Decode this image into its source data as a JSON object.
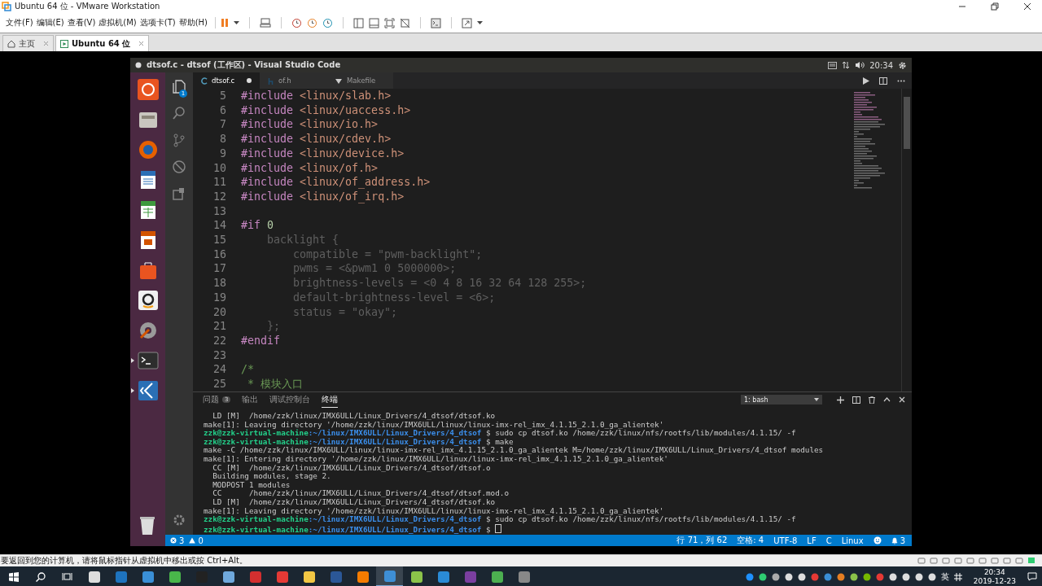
{
  "window": {
    "title": "Ubuntu 64 位 - VMware Workstation"
  },
  "menu": [
    "文件(F)",
    "编辑(E)",
    "查看(V)",
    "虚拟机(M)",
    "选项卡(T)",
    "帮助(H)"
  ],
  "tabs": [
    {
      "label": "主页",
      "kind": "home",
      "selected": false
    },
    {
      "label": "Ubuntu 64 位",
      "kind": "vm",
      "selected": true
    }
  ],
  "ubuntu": {
    "window_title": "dtsof.c - dtsof (工作区) - Visual Studio Code",
    "clock": "20:34",
    "launcher": [
      {
        "running": false
      },
      {
        "running": false
      },
      {
        "running": false
      },
      {
        "running": false
      },
      {
        "running": false
      },
      {
        "running": false
      },
      {
        "running": false
      },
      {
        "running": false
      },
      {
        "running": false
      },
      {
        "running": true
      },
      {
        "running": true
      }
    ]
  },
  "activity_bar": {
    "explorer_badge": "1"
  },
  "editor": {
    "tabs": [
      {
        "label": "dtsof.c",
        "kind": "c",
        "selected": true,
        "modified": true
      },
      {
        "label": "of.h",
        "kind": "h",
        "selected": false,
        "modified": false
      },
      {
        "label": "Makefile",
        "kind": "make",
        "selected": false,
        "modified": false
      }
    ],
    "lines": [
      {
        "number": "5",
        "kind": "directive",
        "directive": "#include",
        "argument": "<linux/slab.h>"
      },
      {
        "number": "6",
        "kind": "directive",
        "directive": "#include",
        "argument": "<linux/uaccess.h>"
      },
      {
        "number": "7",
        "kind": "directive",
        "directive": "#include",
        "argument": "<linux/io.h>"
      },
      {
        "number": "8",
        "kind": "directive",
        "directive": "#include",
        "argument": "<linux/cdev.h>"
      },
      {
        "number": "9",
        "kind": "directive",
        "directive": "#include",
        "argument": "<linux/device.h>"
      },
      {
        "number": "10",
        "kind": "directive",
        "directive": "#include",
        "argument": "<linux/of.h>"
      },
      {
        "number": "11",
        "kind": "directive",
        "directive": "#include",
        "argument": "<linux/of_address.h>"
      },
      {
        "number": "12",
        "kind": "directive",
        "directive": "#include",
        "argument": "<linux/of_irq.h>"
      },
      {
        "number": "13",
        "kind": "blank"
      },
      {
        "number": "14",
        "kind": "directive",
        "directive": "#if",
        "argument": "0"
      },
      {
        "number": "15",
        "kind": "inactive",
        "text": "    backlight {"
      },
      {
        "number": "16",
        "kind": "inactive",
        "text": "        compatible = \"pwm-backlight\";"
      },
      {
        "number": "17",
        "kind": "inactive",
        "text": "        pwms = <&pwm1 0 5000000>;"
      },
      {
        "number": "18",
        "kind": "inactive",
        "text": "        brightness-levels = <0 4 8 16 32 64 128 255>;"
      },
      {
        "number": "19",
        "kind": "inactive",
        "text": "        default-brightness-level = <6>;"
      },
      {
        "number": "20",
        "kind": "inactive",
        "text": "        status = \"okay\";"
      },
      {
        "number": "21",
        "kind": "inactive",
        "text": "    };"
      },
      {
        "number": "22",
        "kind": "directive",
        "directive": "#endif"
      },
      {
        "number": "23",
        "kind": "blank"
      },
      {
        "number": "24",
        "kind": "comment",
        "text": "/*"
      },
      {
        "number": "25",
        "kind": "comment",
        "text": " * 模块入口"
      }
    ]
  },
  "panel": {
    "tabs": [
      {
        "label": "问题",
        "badge": "3",
        "selected": false
      },
      {
        "label": "输出",
        "selected": false
      },
      {
        "label": "调试控制台",
        "selected": false
      },
      {
        "label": "终端",
        "selected": true
      }
    ],
    "terminal_select": "1: bash",
    "lines": [
      {
        "kind": "output",
        "text": "  LD [M]  /home/zzk/linux/IMX6ULL/Linux_Drivers/4_dtsof/dtsof.ko"
      },
      {
        "kind": "output",
        "text": "make[1]: Leaving directory '/home/zzk/linux/IMX6ULL/linux/linux-imx-rel_imx_4.1.15_2.1.0_ga_alientek'"
      },
      {
        "kind": "prompt",
        "user": "zzk@zzk-virtual-machine",
        "path": ":~/linux/IMX6ULL/Linux_Drivers/4_dtsof",
        "command": "$ sudo cp dtsof.ko /home/zzk/linux/nfs/rootfs/lib/modules/4.1.15/ -f",
        "cursor": false
      },
      {
        "kind": "prompt",
        "user": "zzk@zzk-virtual-machine",
        "path": ":~/linux/IMX6ULL/Linux_Drivers/4_dtsof",
        "command": "$ make",
        "cursor": false
      },
      {
        "kind": "output",
        "text": "make -C /home/zzk/linux/IMX6ULL/linux/linux-imx-rel_imx_4.1.15_2.1.0_ga_alientek M=/home/zzk/linux/IMX6ULL/Linux_Drivers/4_dtsof modules"
      },
      {
        "kind": "output",
        "text": "make[1]: Entering directory '/home/zzk/linux/IMX6ULL/linux/linux-imx-rel_imx_4.1.15_2.1.0_ga_alientek'"
      },
      {
        "kind": "output",
        "text": "  CC [M]  /home/zzk/linux/IMX6ULL/Linux_Drivers/4_dtsof/dtsof.o"
      },
      {
        "kind": "output",
        "text": "  Building modules, stage 2."
      },
      {
        "kind": "output",
        "text": "  MODPOST 1 modules"
      },
      {
        "kind": "output",
        "text": "  CC      /home/zzk/linux/IMX6ULL/Linux_Drivers/4_dtsof/dtsof.mod.o"
      },
      {
        "kind": "output",
        "text": "  LD [M]  /home/zzk/linux/IMX6ULL/Linux_Drivers/4_dtsof/dtsof.ko"
      },
      {
        "kind": "output",
        "text": "make[1]: Leaving directory '/home/zzk/linux/IMX6ULL/linux/linux-imx-rel_imx_4.1.15_2.1.0_ga_alientek'"
      },
      {
        "kind": "prompt",
        "user": "zzk@zzk-virtual-machine",
        "path": ":~/linux/IMX6ULL/Linux_Drivers/4_dtsof",
        "command": "$ sudo cp dtsof.ko /home/zzk/linux/nfs/rootfs/lib/modules/4.1.15/ -f",
        "cursor": false
      },
      {
        "kind": "prompt",
        "user": "zzk@zzk-virtual-machine",
        "path": ":~/linux/IMX6ULL/Linux_Drivers/4_dtsof",
        "command": "$",
        "cursor": true
      }
    ]
  },
  "status_bar": {
    "errors": "3",
    "warnings": "0",
    "items": [
      "行 71，列 62",
      "空格: 4",
      "UTF-8",
      "LF",
      "C",
      "Linux"
    ],
    "notifications": "3"
  },
  "vm_hint": "要返回到您的计算机，请将鼠标指针从虚拟机中移出或按 Ctrl+Alt。",
  "taskbar": {
    "apps": [
      {
        "active": false
      },
      {
        "active": false
      },
      {
        "active": false
      },
      {
        "active": false
      },
      {
        "active": false
      },
      {
        "active": false
      },
      {
        "active": false
      },
      {
        "active": false
      },
      {
        "active": false
      },
      {
        "active": false
      },
      {
        "active": false
      },
      {
        "active": true
      },
      {
        "active": false
      },
      {
        "active": false
      },
      {
        "active": false
      },
      {
        "active": false
      },
      {
        "active": false
      }
    ],
    "input_method": "英",
    "time": "20:34",
    "date": "2019-12-23"
  }
}
